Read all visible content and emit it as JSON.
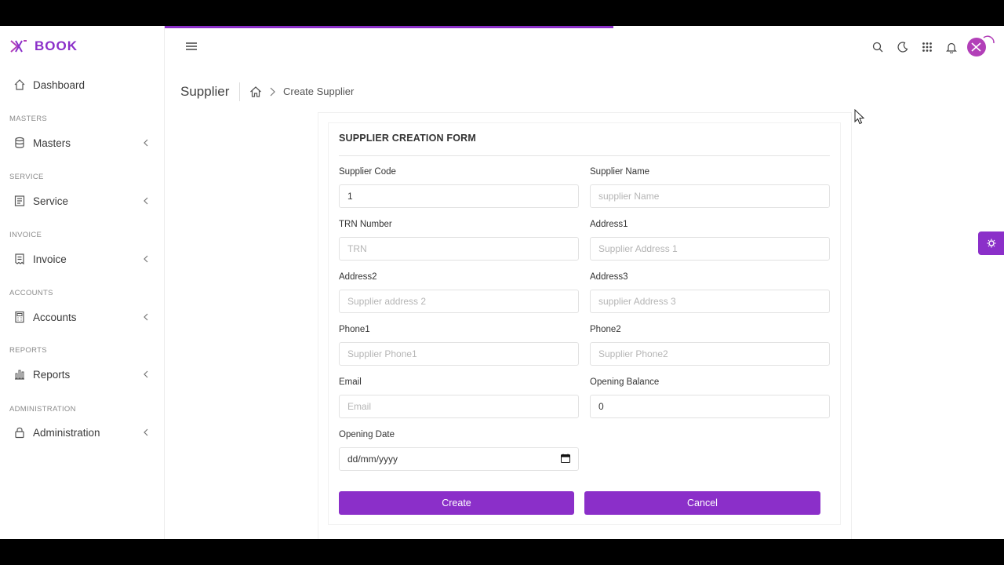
{
  "app": {
    "brand": "BOOK"
  },
  "colors": {
    "accent": "#8b2fc9",
    "avatar": "#b23fb8"
  },
  "sidebar": {
    "items": [
      {
        "label": "Dashboard",
        "icon": "home-icon"
      },
      {
        "section": "MASTERS",
        "label": "Masters",
        "icon": "database-icon"
      },
      {
        "section": "SERVICE",
        "label": "Service",
        "icon": "document-icon"
      },
      {
        "section": "INVOICE",
        "label": "Invoice",
        "icon": "invoice-icon"
      },
      {
        "section": "ACCOUNTS",
        "label": "Accounts",
        "icon": "calculator-icon"
      },
      {
        "section": "REPORTS",
        "label": "Reports",
        "icon": "bar-chart-icon"
      },
      {
        "section": "ADMINISTRATION",
        "label": "Administration",
        "icon": "lock-icon"
      }
    ]
  },
  "topbar": {
    "icons": [
      "menu-icon",
      "search-icon",
      "moon-icon",
      "apps-grid-icon",
      "bell-icon",
      "avatar"
    ]
  },
  "breadcrumb": {
    "title": "Supplier",
    "current": "Create Supplier"
  },
  "form": {
    "title": "SUPPLIER CREATION FORM",
    "fields": {
      "supplier_code": {
        "label": "Supplier Code",
        "value": "1",
        "placeholder": ""
      },
      "supplier_name": {
        "label": "Supplier Name",
        "value": "",
        "placeholder": "supplier Name"
      },
      "trn": {
        "label": "TRN Number",
        "value": "",
        "placeholder": "TRN"
      },
      "address1": {
        "label": "Address1",
        "value": "",
        "placeholder": "Supplier Address 1"
      },
      "address2": {
        "label": "Address2",
        "value": "",
        "placeholder": "Supplier address 2"
      },
      "address3": {
        "label": "Address3",
        "value": "",
        "placeholder": "supplier Address 3"
      },
      "phone1": {
        "label": "Phone1",
        "value": "",
        "placeholder": "Supplier Phone1"
      },
      "phone2": {
        "label": "Phone2",
        "value": "",
        "placeholder": "Supplier Phone2"
      },
      "email": {
        "label": "Email",
        "value": "",
        "placeholder": "Email"
      },
      "opening_balance": {
        "label": "Opening Balance",
        "value": "0",
        "placeholder": ""
      },
      "opening_date": {
        "label": "Opening Date",
        "value": "dd/mm/yyyy"
      }
    },
    "buttons": {
      "create": "Create",
      "cancel": "Cancel"
    }
  }
}
